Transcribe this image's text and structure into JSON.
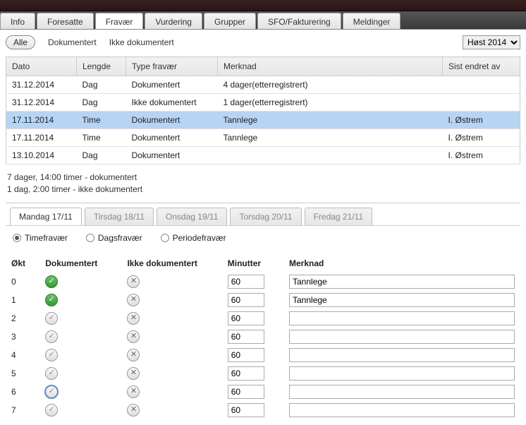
{
  "mainTabs": [
    "Info",
    "Foresatte",
    "Fravær",
    "Vurdering",
    "Grupper",
    "SFO/Fakturering",
    "Meldinger"
  ],
  "mainTabActive": 2,
  "filters": {
    "all": "Alle",
    "doc": "Dokumentert",
    "undoc": "Ikke dokumentert"
  },
  "term": {
    "selected": "Høst 2014"
  },
  "tableHeaders": {
    "date": "Dato",
    "length": "Lengde",
    "type": "Type fravær",
    "note": "Merknad",
    "editedBy": "Sist endret av"
  },
  "rows": [
    {
      "date": "31.12.2014",
      "length": "Dag",
      "type": "Dokumentert",
      "note": "4 dager(etterregistrert)",
      "editedBy": "",
      "selected": false
    },
    {
      "date": "31.12.2014",
      "length": "Dag",
      "type": "Ikke dokumentert",
      "note": "1 dager(etterregistrert)",
      "editedBy": "",
      "selected": false
    },
    {
      "date": "17.11.2014",
      "length": "Time",
      "type": "Dokumentert",
      "note": "Tannlege",
      "editedBy": "I. Østrem",
      "selected": true
    },
    {
      "date": "17.11.2014",
      "length": "Time",
      "type": "Dokumentert",
      "note": "Tannlege",
      "editedBy": "I. Østrem",
      "selected": false
    },
    {
      "date": "13.10.2014",
      "length": "Dag",
      "type": "Dokumentert",
      "note": "",
      "editedBy": "I. Østrem",
      "selected": false
    }
  ],
  "summary": {
    "line1": "7 dager, 14:00 timer - dokumentert",
    "line2": "1 dag, 2:00 timer - ikke dokumentert"
  },
  "dayTabs": [
    "Mandag 17/11",
    "Tirsdag 18/11",
    "Onsdag 19/11",
    "Torsdag 20/11",
    "Fredag 21/11"
  ],
  "dayTabActive": 0,
  "absenceType": {
    "hourly": "Timefravær",
    "daily": "Dagsfravær",
    "period": "Periodefravær",
    "selected": "hourly"
  },
  "sessionHeaders": {
    "session": "Økt",
    "documented": "Dokumentert",
    "undocumented": "Ikke dokumentert",
    "minutes": "Minutter",
    "note": "Merknad"
  },
  "sessions": [
    {
      "session": "0",
      "docState": "green",
      "minutes": "60",
      "note": "Tannlege",
      "focus": false
    },
    {
      "session": "1",
      "docState": "green",
      "minutes": "60",
      "note": "Tannlege",
      "focus": false
    },
    {
      "session": "2",
      "docState": "gray",
      "minutes": "60",
      "note": "",
      "focus": false
    },
    {
      "session": "3",
      "docState": "gray",
      "minutes": "60",
      "note": "",
      "focus": false
    },
    {
      "session": "4",
      "docState": "gray",
      "minutes": "60",
      "note": "",
      "focus": false
    },
    {
      "session": "5",
      "docState": "gray",
      "minutes": "60",
      "note": "",
      "focus": false
    },
    {
      "session": "6",
      "docState": "gray",
      "minutes": "60",
      "note": "",
      "focus": true
    },
    {
      "session": "7",
      "docState": "gray",
      "minutes": "60",
      "note": "",
      "focus": false
    }
  ]
}
